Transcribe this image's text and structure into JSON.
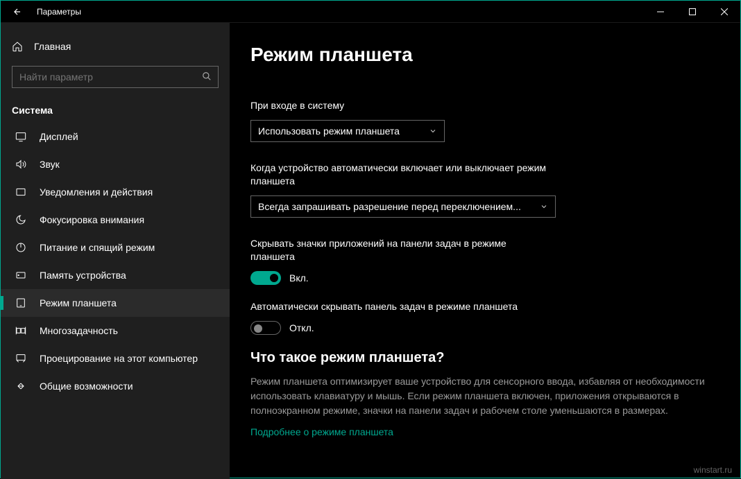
{
  "window": {
    "title": "Параметры"
  },
  "sidebar": {
    "home": "Главная",
    "search_placeholder": "Найти параметр",
    "heading": "Система",
    "items": [
      {
        "label": "Дисплей"
      },
      {
        "label": "Звук"
      },
      {
        "label": "Уведомления и действия"
      },
      {
        "label": "Фокусировка внимания"
      },
      {
        "label": "Питание и спящий режим"
      },
      {
        "label": "Память устройства"
      },
      {
        "label": "Режим планшета"
      },
      {
        "label": "Многозадачность"
      },
      {
        "label": "Проецирование на этот компьютер"
      },
      {
        "label": "Общие возможности"
      }
    ]
  },
  "main": {
    "title": "Режим планшета",
    "signin_label": "При входе в систему",
    "signin_value": "Использовать режим планшета",
    "auto_label": "Когда устройство автоматически включает или выключает режим планшета",
    "auto_value": "Всегда запрашивать разрешение перед переключением...",
    "hide_icons_label": "Скрывать значки приложений на панели задач в режиме планшета",
    "hide_icons_state": "Вкл.",
    "auto_hide_taskbar_label": "Автоматически скрывать панель задач в режиме планшета",
    "auto_hide_taskbar_state": "Откл.",
    "what_is_heading": "Что такое режим планшета?",
    "what_is_desc": "Режим планшета оптимизирует ваше устройство для сенсорного ввода, избавляя от необходимости использовать клавиатуру и мышь. Если режим планшета включен, приложения открываются в полноэкранном режиме, значки на панели задач и рабочем столе уменьшаются в размерах.",
    "learn_more": "Подробнее о режиме планшета"
  },
  "footer": {
    "watermark": "winstart.ru"
  }
}
